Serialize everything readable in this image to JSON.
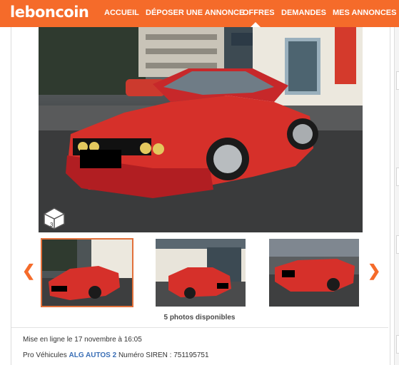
{
  "brand": {
    "logo_text": "leboncoin",
    "color": "#f56b2a"
  },
  "nav": {
    "items": [
      {
        "label": "ACCUEIL"
      },
      {
        "label": "DÉPOSER UNE ANNONCE"
      },
      {
        "label": "OFFRES"
      },
      {
        "label": "DEMANDES"
      },
      {
        "label": "MES ANNONCES"
      }
    ],
    "active": "OFFRES"
  },
  "gallery": {
    "main_photo_icon": "car-photo",
    "badge_icon": "3d-cube-icon",
    "badge_text": "3",
    "thumbnails": [
      {
        "icon": "car-thumbnail",
        "selected": true
      },
      {
        "icon": "car-thumbnail",
        "selected": false
      },
      {
        "icon": "car-thumbnail",
        "selected": false
      }
    ],
    "prev_icon": "chevron-left-icon",
    "next_icon": "chevron-right-icon",
    "prev_glyph": "❮",
    "next_glyph": "❯",
    "photos_count": "5 photos disponibles"
  },
  "listing": {
    "posted_label": "Mise en ligne le 17 novembre à 16:05",
    "pro_prefix": "Pro Véhicules",
    "seller_name": "ALG AUTOS 2",
    "siren_label": "Numéro SIREN : 751195751"
  }
}
